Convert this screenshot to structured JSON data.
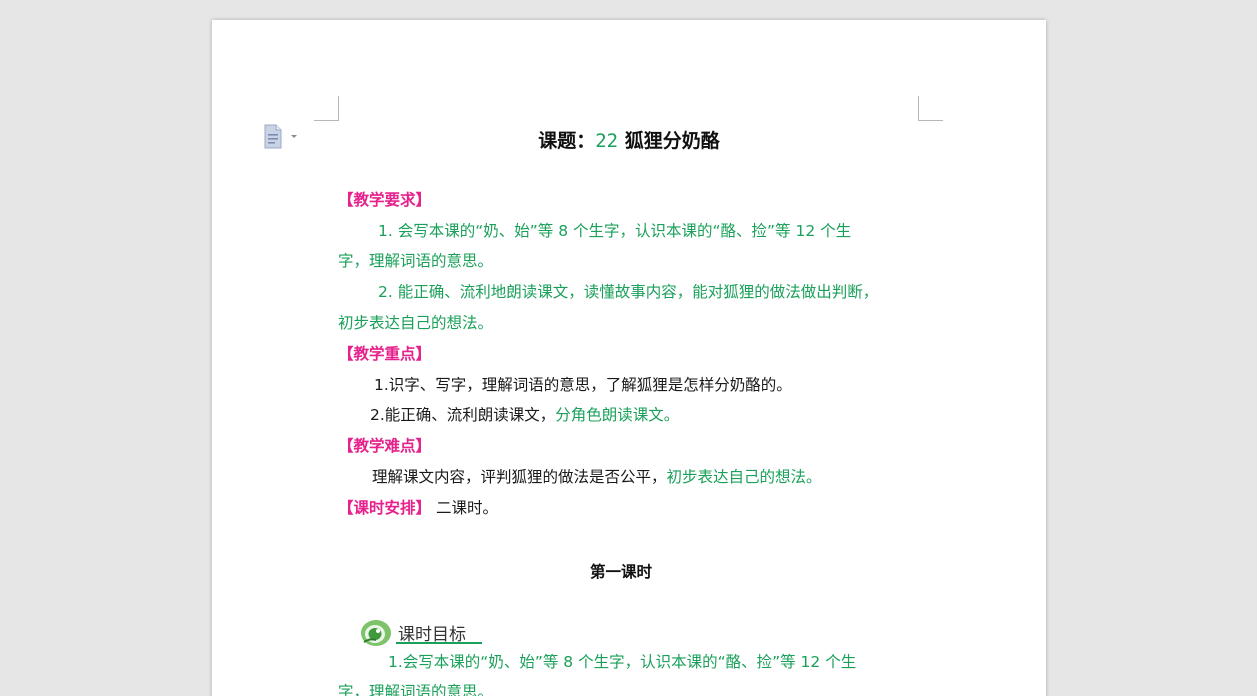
{
  "document": {
    "title_prefix": "课题：",
    "title_number": "22",
    "title_text": "狐狸分奶酪",
    "sections": {
      "requirements_heading": "【教学要求】",
      "req1_line1": "1. 会写本课的“奶、始”等 8 个生字，认识本课的“酪、捡”等 12 个生",
      "req1_line2": "字，理解词语的意思。",
      "req2_line1": "2. 能正确、流利地朗读课文，读懂故事内容，能对狐狸的做法做出判断，",
      "req2_line2": "初步表达自己的想法。",
      "keypoints_heading": "【教学重点】",
      "key1": "1.识字、写字，理解词语的意思，了解狐狸是怎样分奶酪的。",
      "key2_black": "2.能正确、流利朗读课文，",
      "key2_green": "分角色朗读课文。",
      "difficulties_heading": "【教学难点】",
      "diff_black": "理解课文内容，评判狐狸的做法是否公平，",
      "diff_green": "初步表达自己的想法。",
      "schedule_heading": "【课时安排】",
      "schedule_text": " 二课时。"
    },
    "lesson_title": "第一课时",
    "objectives_label": "课时目标",
    "obj1_line1": "1.会写本课的“奶、始”等 8 个生字，认识本课的“酪、捡”等 12 个生",
    "obj1_line2": "字，理解词语的意思。"
  },
  "colors": {
    "green_text": "#1aa05a",
    "magenta_heading": "#e6218c",
    "background": "#e6e6e6",
    "page": "#ffffff"
  },
  "icons": {
    "document": "document-icon",
    "dropdown": "caret-down-icon",
    "objective": "leaf-badge-icon"
  }
}
